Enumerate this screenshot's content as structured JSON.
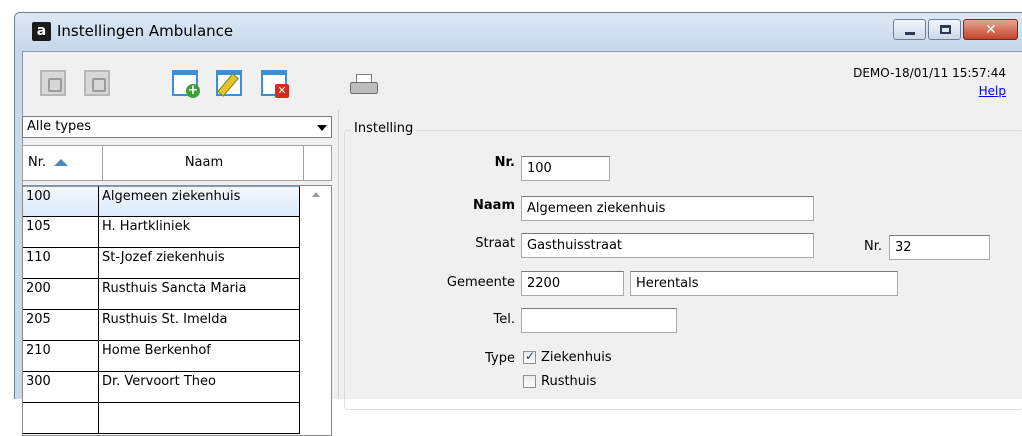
{
  "window": {
    "app_icon_letter": "a",
    "title": "Instellingen Ambulance",
    "close_glyph": "✕"
  },
  "toolbar": {
    "status_text": "DEMO-18/01/11 15:57:44",
    "help_label": "Help",
    "icons": [
      "save-confirm-icon",
      "save-cancel-icon",
      "add-record-icon",
      "edit-record-icon",
      "delete-record-icon",
      "printer-icon"
    ]
  },
  "filter": {
    "selected": "Alle types"
  },
  "list": {
    "columns": {
      "nr": "Nr.",
      "naam": "Naam"
    },
    "rows": [
      {
        "nr": "100",
        "naam": "Algemeen ziekenhuis"
      },
      {
        "nr": "105",
        "naam": "H. Hartkliniek"
      },
      {
        "nr": "110",
        "naam": "St-Jozef ziekenhuis"
      },
      {
        "nr": "200",
        "naam": "Rusthuis Sancta Maria"
      },
      {
        "nr": "205",
        "naam": "Rusthuis St. Imelda"
      },
      {
        "nr": "210",
        "naam": "Home Berkenhof"
      },
      {
        "nr": "300",
        "naam": "Dr. Vervoort Theo"
      }
    ]
  },
  "detail": {
    "group_title": "Instelling",
    "nr_label": "Nr.",
    "nr_value": "100",
    "naam_label": "Naam",
    "naam_value": "Algemeen ziekenhuis",
    "straat_label": "Straat",
    "straat_value": "Gasthuisstraat",
    "huisnr_label": "Nr.",
    "huisnr_value": "32",
    "gemeente_label": "Gemeente",
    "postcode_value": "2200",
    "gemeente_value": "Herentals",
    "tel_label": "Tel.",
    "tel_value": "",
    "type_label": "Type",
    "type_options": [
      {
        "label": "Ziekenhuis",
        "checked": true
      },
      {
        "label": "Rusthuis",
        "checked": false
      }
    ]
  },
  "colors": {
    "title_bar": "#c6d7ec",
    "close_button": "#c4432b",
    "selection": "#dcebfb",
    "link": "#0000ee"
  }
}
